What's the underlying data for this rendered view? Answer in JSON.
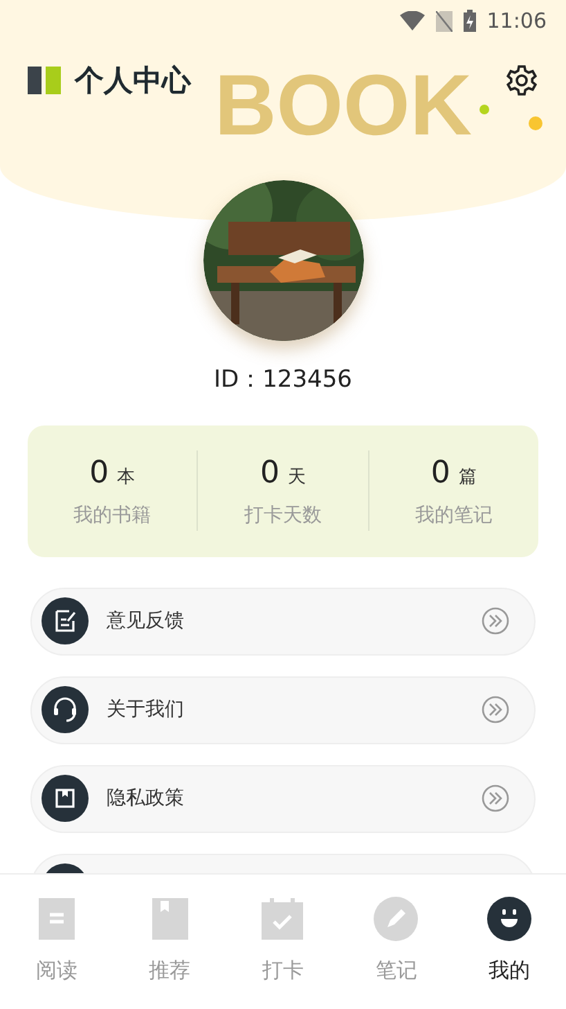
{
  "status_bar": {
    "time": "11:06"
  },
  "header": {
    "title": "个人中心",
    "background_text": "BOOK"
  },
  "profile": {
    "id_label": "ID：123456"
  },
  "stats": [
    {
      "value": "0",
      "unit": "本",
      "label": "我的书籍"
    },
    {
      "value": "0",
      "unit": "天",
      "label": "打卡天数"
    },
    {
      "value": "0",
      "unit": "篇",
      "label": "我的笔记"
    }
  ],
  "menu": [
    {
      "kind": "feedback",
      "label": "意见反馈"
    },
    {
      "kind": "headset",
      "label": "关于我们"
    },
    {
      "kind": "book",
      "label": "隐私政策"
    },
    {
      "kind": "partial"
    }
  ],
  "tabs": [
    {
      "kind": "doc",
      "label": "阅读",
      "selected": false
    },
    {
      "kind": "bookmark",
      "label": "推荐",
      "selected": false
    },
    {
      "kind": "calendar",
      "label": "打卡",
      "selected": false
    },
    {
      "kind": "pencil",
      "label": "笔记",
      "selected": false
    },
    {
      "kind": "smile",
      "label": "我的",
      "selected": true
    }
  ]
}
